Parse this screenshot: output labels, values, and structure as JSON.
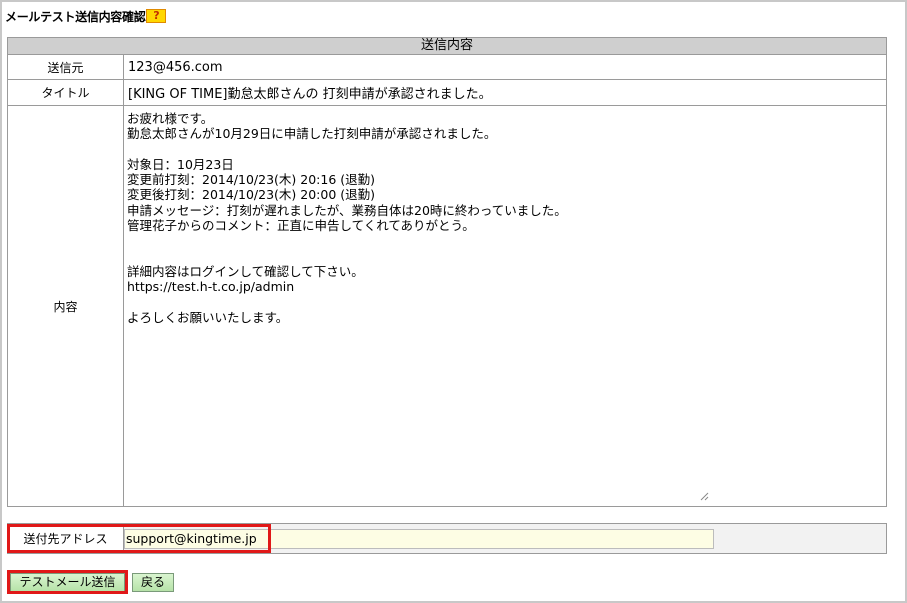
{
  "page": {
    "title": "メールテスト送信内容確認",
    "help_label": "?"
  },
  "content": {
    "section_header": "送信内容",
    "sender_label": "送信元",
    "sender_value": "123@456.com",
    "title_label": "タイトル",
    "title_value": "[KING OF TIME]勤怠太郎さんの 打刻申請が承認されました。",
    "body_label": "内容",
    "body_value": "お疲れ様です。\n勤怠太郎さんが10月29日に申請した打刻申請が承認されました。\n\n対象日：10月23日\n変更前打刻：2014/10/23(木) 20:16 (退勤)\n変更後打刻：2014/10/23(木) 20:00 (退勤)\n申請メッセージ：打刻が遅れましたが、業務自体は20時に終わっていました。\n管理花子からのコメント：正直に申告してくれてありがとう。\n\n\n詳細内容はログインして確認して下さい。\nhttps://test.h-t.co.jp/admin\n\nよろしくお願いいたします。"
  },
  "address": {
    "label": "送付先アドレス",
    "value": "support@kingtime.jp"
  },
  "buttons": {
    "send_label": "テストメール送信",
    "back_label": "戻る"
  },
  "colors": {
    "highlight": "#e01818",
    "header_bg": "#cfcfcf",
    "button_green": "#b6e2a8",
    "input_bg": "#fdfde4"
  }
}
